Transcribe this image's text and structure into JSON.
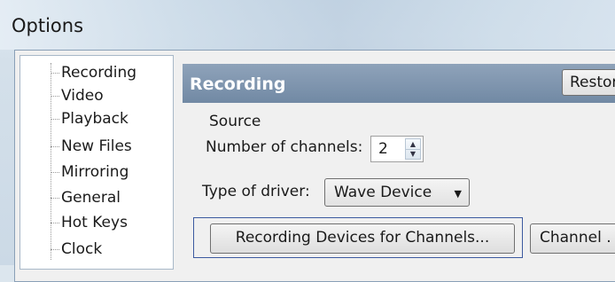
{
  "window": {
    "title": "Options"
  },
  "tree": {
    "items": [
      {
        "label": "Recording"
      },
      {
        "label": "Video"
      },
      {
        "label": "Playback"
      },
      {
        "label": "New Files"
      },
      {
        "label": "Mirroring"
      },
      {
        "label": "General"
      },
      {
        "label": "Hot Keys"
      },
      {
        "label": "Clock"
      }
    ]
  },
  "panel": {
    "title": "Recording",
    "restore_label": "Restor",
    "source_label": "Source",
    "channels": {
      "label": "Number of channels:",
      "value": "2"
    },
    "driver": {
      "label": "Type of driver:",
      "value": "Wave Device"
    },
    "recording_devices_label": "Recording Devices for Channels...",
    "channel_label": "Channel ."
  },
  "icons": {
    "spin_up": "chevron-up-icon",
    "spin_down": "chevron-down-icon",
    "dropdown": "dropdown-arrow-icon"
  },
  "colors": {
    "header_bg": "#7a90a9",
    "focus_border": "#3c5aa0"
  }
}
